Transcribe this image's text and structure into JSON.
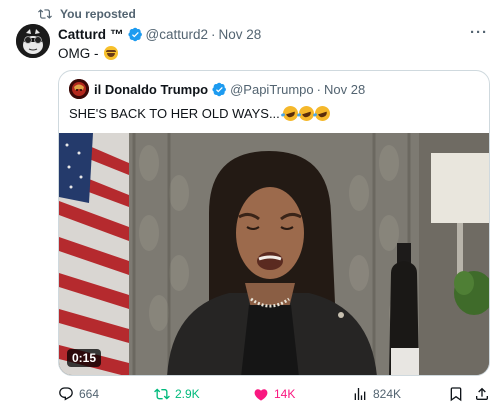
{
  "repost_banner": {
    "text": "You reposted"
  },
  "author": {
    "name": "Catturd",
    "badge": "™",
    "handle": "@catturd2",
    "separator": "·",
    "date": "Nov 28"
  },
  "tweet": {
    "text": "OMG -"
  },
  "quoted": {
    "name": "il Donaldo Trumpo",
    "handle": "@PapiTrumpo",
    "separator": "·",
    "date": "Nov 28",
    "text": "SHE'S BACK TO HER OLD WAYS...",
    "video_duration": "0:15"
  },
  "actions": {
    "replies": "664",
    "reposts": "2.9K",
    "likes": "14K",
    "views": "824K"
  },
  "colors": {
    "verified": "#1d9bf0",
    "repost_active": "#00ba7c",
    "like_active": "#f91880",
    "muted": "#536471"
  },
  "icons": [
    "repost-icon",
    "verified-icon",
    "more-icon",
    "reply-icon",
    "retweet-icon",
    "heart-icon",
    "views-icon",
    "bookmark-icon",
    "share-icon"
  ]
}
